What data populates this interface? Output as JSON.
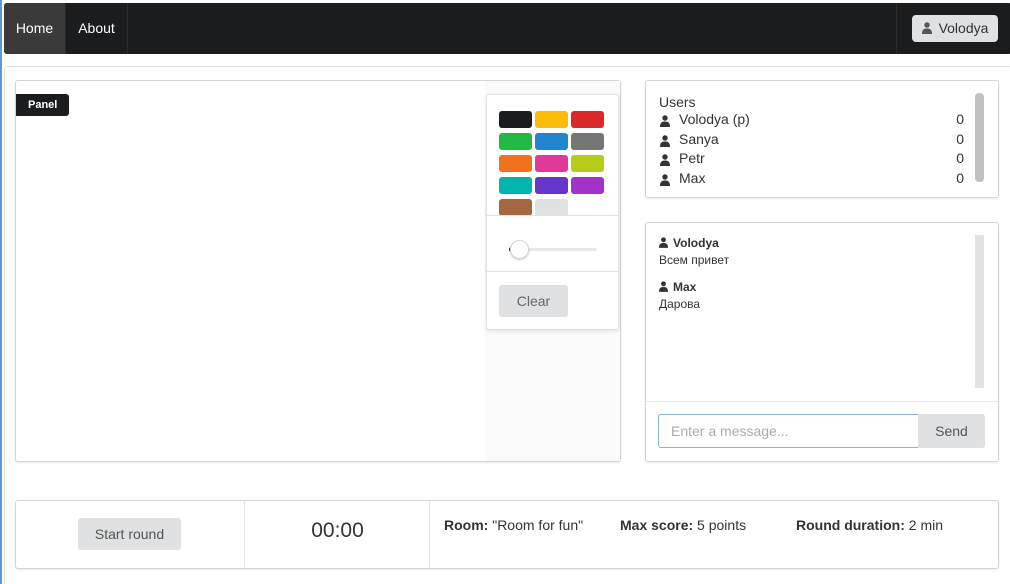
{
  "navbar": {
    "home_label": "Home",
    "about_label": "About",
    "user_label": "Volodya"
  },
  "canvas": {
    "panel_label": "Panel",
    "palette": [
      "#1b1c1d",
      "#fbbd08",
      "#db2828",
      "#21ba45",
      "#2185d0",
      "#767676",
      "#f2711c",
      "#e03997",
      "#b5cc18",
      "#00b5ad",
      "#6435c9",
      "#a333c8",
      "#a5673f",
      "#e0e1e2"
    ],
    "brush_size_fraction": 0.1,
    "clear_label": "Clear"
  },
  "users": {
    "title": "Users",
    "list": [
      {
        "name": "Volodya (p)",
        "score": "0"
      },
      {
        "name": "Sanya",
        "score": "0"
      },
      {
        "name": "Petr",
        "score": "0"
      },
      {
        "name": "Max",
        "score": "0"
      }
    ]
  },
  "chat": {
    "messages": [
      {
        "author": "Volodya",
        "text": "Всем привет"
      },
      {
        "author": "Max",
        "text": "Дарова"
      }
    ],
    "input_placeholder": "Enter a message...",
    "send_label": "Send"
  },
  "footer": {
    "start_label": "Start round",
    "timer": "00:00",
    "room_label": "Room:",
    "room_value": "\"Room for fun\"",
    "max_score_label": "Max score:",
    "max_score_value": "5 points",
    "round_duration_label": "Round duration:",
    "round_duration_value": "2 min"
  },
  "colors": {
    "navbar_bg": "#1b1c1d",
    "button_bg": "#e0e1e2",
    "input_focus_border": "#85b7d9"
  }
}
